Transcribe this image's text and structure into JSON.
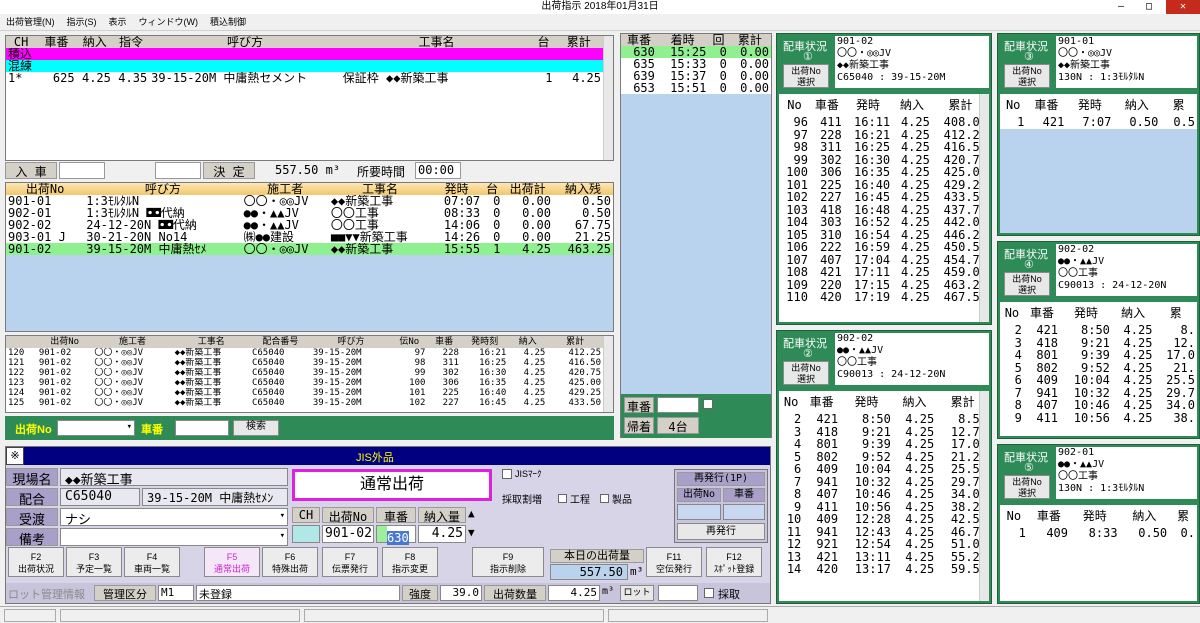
{
  "window": {
    "title": "出荷指示  2018年01月31日",
    "min": "—",
    "max": "□",
    "close": "✕"
  },
  "menu": [
    "出荷管理(N)",
    "指示(S)",
    "表示",
    "ウィンドウ(W)",
    "積込制御"
  ],
  "colors": {
    "magenta": "#ff00ff",
    "cyan": "#00ffff",
    "green_highlight": "#8ef08e",
    "lightblue": "#b9d3ee",
    "darkgreen": "#2e8b57",
    "navy": "#000080"
  },
  "ch_table": {
    "headers": [
      "CH",
      "車番",
      "納入",
      "指令",
      "呼び方",
      "工事名",
      "台",
      "累計"
    ],
    "rows": [
      {
        "cells": [
          "積込",
          "",
          "",
          "",
          "",
          "",
          "",
          ""
        ],
        "style": "magenta"
      },
      {
        "cells": [
          "混練",
          "",
          "",
          "",
          "",
          "",
          "",
          ""
        ],
        "style": "cyan"
      },
      {
        "cells": [
          "1*",
          "625",
          "4.25",
          "4.35",
          "39-15-20M 中庸熱セメント",
          "保証枠 ◆◆新築工事",
          "1",
          "4.25"
        ],
        "style": "white"
      }
    ]
  },
  "entry": {
    "label": "入 車",
    "decide": "決 定",
    "volume": "557.50 m³",
    "time_label": "所要時間",
    "time": "00:00"
  },
  "ship_table": {
    "headers": [
      "出荷No",
      "呼び方",
      "施工者",
      "工事名",
      "発時",
      "台",
      "出荷計",
      "納入残"
    ],
    "rows": [
      [
        "901-01",
        "1:3ﾓﾙﾀﾙN",
        "〇〇・◎◎JV",
        "◆◆新築工事",
        "07:07",
        "0",
        "0.00",
        "0.50"
      ],
      [
        "902-01",
        "1:3ﾓﾙﾀﾙN  ◘◘代納",
        "●●・▲▲JV",
        "〇〇工事",
        "08:33",
        "0",
        "0.00",
        "0.50"
      ],
      [
        "902-02",
        "24-12-20N ◘◘代納",
        "●●・▲▲JV",
        "〇〇工事",
        "14:06",
        "0",
        "0.00",
        "67.75"
      ],
      [
        "903-01 J",
        "30-21-20N No14",
        "㈱●●建設",
        "■■▼▼新築工事",
        "14:26",
        "0",
        "0.00",
        "21.25"
      ],
      [
        "901-02",
        "39-15-20M 中庸熱ｾﾒ",
        "〇〇・◎◎JV",
        "◆◆新築工事",
        "15:55",
        "1",
        "4.25",
        "463.25"
      ]
    ]
  },
  "detail_table": {
    "headers": [
      "",
      "出荷No",
      "施工者",
      "工事名",
      "配合番号",
      "呼び方",
      "伝No",
      "車番",
      "発時刻",
      "納入",
      "累計"
    ],
    "rows": [
      [
        "120",
        "901-02",
        "〇〇・◎◎JV",
        "◆◆新築工事",
        "C65040",
        "39-15-20M",
        "97",
        "228",
        "16:21",
        "4.25",
        "412.25"
      ],
      [
        "121",
        "901-02",
        "〇〇・◎◎JV",
        "◆◆新築工事",
        "C65040",
        "39-15-20M",
        "98",
        "311",
        "16:25",
        "4.25",
        "416.50"
      ],
      [
        "122",
        "901-02",
        "〇〇・◎◎JV",
        "◆◆新築工事",
        "C65040",
        "39-15-20M",
        "99",
        "302",
        "16:30",
        "4.25",
        "420.75"
      ],
      [
        "123",
        "901-02",
        "〇〇・◎◎JV",
        "◆◆新築工事",
        "C65040",
        "39-15-20M",
        "100",
        "306",
        "16:35",
        "4.25",
        "425.00"
      ],
      [
        "124",
        "901-02",
        "〇〇・◎◎JV",
        "◆◆新築工事",
        "C65040",
        "39-15-20M",
        "101",
        "225",
        "16:40",
        "4.25",
        "429.25"
      ],
      [
        "125",
        "901-02",
        "〇〇・◎◎JV",
        "◆◆新築工事",
        "C65040",
        "39-15-20M",
        "102",
        "227",
        "16:45",
        "4.25",
        "433.50"
      ]
    ]
  },
  "search": {
    "label": "出荷No",
    "car_label": "車番",
    "button": "検索"
  },
  "vehicles": {
    "headers": [
      "車番",
      "着時",
      "回",
      "累計"
    ],
    "rows": [
      [
        "630",
        "15:25",
        "0",
        "0.00"
      ],
      [
        "635",
        "15:33",
        "0",
        "0.00"
      ],
      [
        "639",
        "15:37",
        "0",
        "0.00"
      ],
      [
        "653",
        "15:51",
        "0",
        "0.00"
      ]
    ],
    "car_label": "車番",
    "return_label": "帰着",
    "return_count": "4台"
  },
  "form": {
    "close": "※",
    "jis": "JIS外品",
    "site_label": "現場名",
    "site": "◆◆新築工事",
    "mix_label": "配合",
    "mix_code": "C65040",
    "mix_name": "39-15-20M 中庸熱ｾﾒﾝ",
    "receive_label": "受渡",
    "receive": "ナシ",
    "note_label": "備考",
    "note": "",
    "mode": "通常出荷",
    "jis_mark": "JISﾏｰｸ",
    "sample_label": "採取割増",
    "process": "工程",
    "product": "製品",
    "ch_label": "CH",
    "ship_label": "出荷No",
    "car_label": "車番",
    "qty_label": "納入量",
    "ship_no": "901-02",
    "car_no": "630",
    "qty": "4.25",
    "reissue_title": "再発行(1P)",
    "reissue_ship": "出荷No",
    "reissue_car": "車番",
    "reissue_btn": "再発行",
    "today_label": "本日の出荷量",
    "today": "557.50",
    "today_unit": "m³"
  },
  "fkeys": [
    {
      "key": "F2",
      "label": "出荷状況"
    },
    {
      "key": "F3",
      "label": "予定一覧"
    },
    {
      "key": "F4",
      "label": "車両一覧"
    },
    {
      "key": "F5",
      "label": "通常出荷",
      "accent": true
    },
    {
      "key": "F6",
      "label": "特殊出荷"
    },
    {
      "key": "F7",
      "label": "伝票発行"
    },
    {
      "key": "F8",
      "label": "指示変更"
    },
    {
      "key": "F9",
      "label": "指示削除"
    },
    {
      "key": "F11",
      "label": "空伝発行"
    },
    {
      "key": "F12",
      "label": "ｽﾎﾟｯﾄ登録"
    }
  ],
  "lot": {
    "label": "ロット管理情報",
    "kbn_label": "管理区分",
    "kbn": "M1",
    "status": "未登録",
    "strength_label": "強度",
    "strength": "39.0",
    "amount_label": "出荷数量",
    "amount": "4.25",
    "unit": "m³",
    "lot_btn": "ロット",
    "collect": "採取"
  },
  "status_cards": [
    {
      "id": "c1",
      "title": "配車状況",
      "num": "①",
      "ship": "901-02",
      "line1": "〇〇・◎◎JV",
      "line2": "◆◆新築工事",
      "line3": "C65040  :  39-15-20M",
      "select": "出荷No選択",
      "headers": [
        "No",
        "車番",
        "発時",
        "納入",
        "累計"
      ],
      "rows": [
        [
          "96",
          "411",
          "16:11",
          "4.25",
          "408.00"
        ],
        [
          "97",
          "228",
          "16:21",
          "4.25",
          "412.25"
        ],
        [
          "98",
          "311",
          "16:25",
          "4.25",
          "416.50"
        ],
        [
          "99",
          "302",
          "16:30",
          "4.25",
          "420.75"
        ],
        [
          "100",
          "306",
          "16:35",
          "4.25",
          "425.00"
        ],
        [
          "101",
          "225",
          "16:40",
          "4.25",
          "429.25"
        ],
        [
          "102",
          "227",
          "16:45",
          "4.25",
          "433.50"
        ],
        [
          "103",
          "418",
          "16:48",
          "4.25",
          "437.75"
        ],
        [
          "104",
          "303",
          "16:52",
          "4.25",
          "442.00"
        ],
        [
          "105",
          "310",
          "16:54",
          "4.25",
          "446.25"
        ],
        [
          "106",
          "222",
          "16:59",
          "4.25",
          "450.50"
        ],
        [
          "107",
          "407",
          "17:04",
          "4.25",
          "454.75"
        ],
        [
          "108",
          "421",
          "17:11",
          "4.25",
          "459.00"
        ],
        [
          "109",
          "220",
          "17:15",
          "4.25",
          "463.25"
        ],
        [
          "110",
          "420",
          "17:19",
          "4.25",
          "467.50"
        ]
      ]
    },
    {
      "id": "c2",
      "title": "配車状況",
      "num": "②",
      "ship": "902-02",
      "line1": "●●・▲▲JV",
      "line2": "〇〇工事",
      "line3": "C90013  :  24-12-20N",
      "select": "出荷No選択",
      "headers": [
        "No",
        "車番",
        "発時",
        "納入",
        "累計"
      ],
      "rows": [
        [
          "2",
          "421",
          "8:50",
          "4.25",
          "8.50"
        ],
        [
          "3",
          "418",
          "9:21",
          "4.25",
          "12.75"
        ],
        [
          "4",
          "801",
          "9:39",
          "4.25",
          "17.00"
        ],
        [
          "5",
          "802",
          "9:52",
          "4.25",
          "21.25"
        ],
        [
          "6",
          "409",
          "10:04",
          "4.25",
          "25.50"
        ],
        [
          "7",
          "941",
          "10:32",
          "4.25",
          "29.75"
        ],
        [
          "8",
          "407",
          "10:46",
          "4.25",
          "34.00"
        ],
        [
          "9",
          "411",
          "10:56",
          "4.25",
          "38.25"
        ],
        [
          "10",
          "409",
          "12:28",
          "4.25",
          "42.50"
        ],
        [
          "11",
          "941",
          "12:43",
          "4.25",
          "46.75"
        ],
        [
          "12",
          "921",
          "12:54",
          "4.25",
          "51.00"
        ],
        [
          "13",
          "421",
          "13:11",
          "4.25",
          "55.25"
        ],
        [
          "14",
          "420",
          "13:17",
          "4.25",
          "59.50"
        ]
      ]
    },
    {
      "id": "c3",
      "title": "配車状況",
      "num": "③",
      "ship": "901-01",
      "line1": "〇〇・◎◎JV",
      "line2": "◆◆新築工事",
      "line3": "130N  :  1:3ﾓﾙﾀﾙN",
      "select": "出荷No選択",
      "headers": [
        "No",
        "車番",
        "発時",
        "納入",
        "累"
      ],
      "rows": [
        [
          "1",
          "421",
          "7:07",
          "0.50",
          "0.5"
        ]
      ]
    },
    {
      "id": "c4",
      "title": "配車状況",
      "num": "④",
      "ship": "902-02",
      "line1": "●●・▲▲JV",
      "line2": "〇〇工事",
      "line3": "C90013  :  24-12-20N",
      "select": "出荷No選択",
      "headers": [
        "No",
        "車番",
        "発時",
        "納入",
        "累"
      ],
      "rows": [
        [
          "2",
          "421",
          "8:50",
          "4.25",
          "8."
        ],
        [
          "3",
          "418",
          "9:21",
          "4.25",
          "12."
        ],
        [
          "4",
          "801",
          "9:39",
          "4.25",
          "17.0"
        ],
        [
          "5",
          "802",
          "9:52",
          "4.25",
          "21."
        ],
        [
          "6",
          "409",
          "10:04",
          "4.25",
          "25.5"
        ],
        [
          "7",
          "941",
          "10:32",
          "4.25",
          "29.7"
        ],
        [
          "8",
          "407",
          "10:46",
          "4.25",
          "34.0"
        ],
        [
          "9",
          "411",
          "10:56",
          "4.25",
          "38."
        ]
      ]
    },
    {
      "id": "c5",
      "title": "配車状況",
      "num": "⑤",
      "ship": "902-01",
      "line1": "●●・▲▲JV",
      "line2": "〇〇工事",
      "line3": "130N  :  1:3ﾓﾙﾀﾙN",
      "select": "出荷No選択",
      "headers": [
        "No",
        "車番",
        "発時",
        "納入",
        "累"
      ],
      "rows": [
        [
          "1",
          "409",
          "8:33",
          "0.50",
          "0."
        ]
      ]
    }
  ]
}
